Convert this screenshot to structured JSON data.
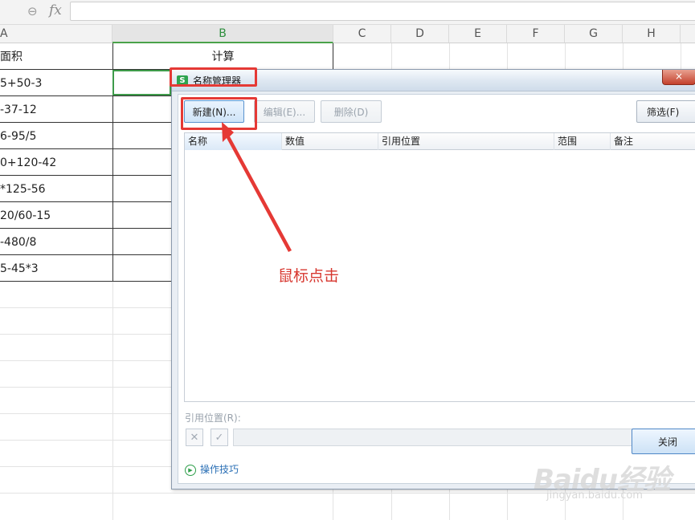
{
  "formula_bar": {
    "fx_label": "fx",
    "zoom_icon": "magnifier-icon"
  },
  "columns": [
    "A",
    "B",
    "C",
    "D",
    "E",
    "F",
    "G",
    "H"
  ],
  "sheet": {
    "a_header": "面积",
    "b_header": "计算",
    "rows": [
      "5+50-3",
      "-37-12",
      "6-95/5",
      "0+120-42",
      "*125-56",
      "20/60-15",
      "-480/8",
      "5-45*3"
    ]
  },
  "dialog": {
    "title": "名称管理器",
    "app_icon": "S",
    "close_x": "×",
    "buttons": {
      "new": "新建(N)...",
      "edit": "编辑(E)...",
      "delete": "删除(D)",
      "filter": "筛选(F)"
    },
    "list_headers": [
      "名称",
      "数值",
      "引用位置",
      "范围",
      "备注"
    ],
    "ref_label": "引用位置(R):",
    "tips": "操作技巧",
    "close": "关闭",
    "cancel_glyph": "✕",
    "confirm_glyph": "✓"
  },
  "annotation": {
    "text": "鼠标点击"
  },
  "watermark": {
    "logo": "Baidu经验",
    "url": "jingyan.baidu.com"
  },
  "colors": {
    "annotation_red": "#e53935",
    "active_cell_green": "#3e9b4a",
    "link_blue": "#2a6fb5"
  }
}
